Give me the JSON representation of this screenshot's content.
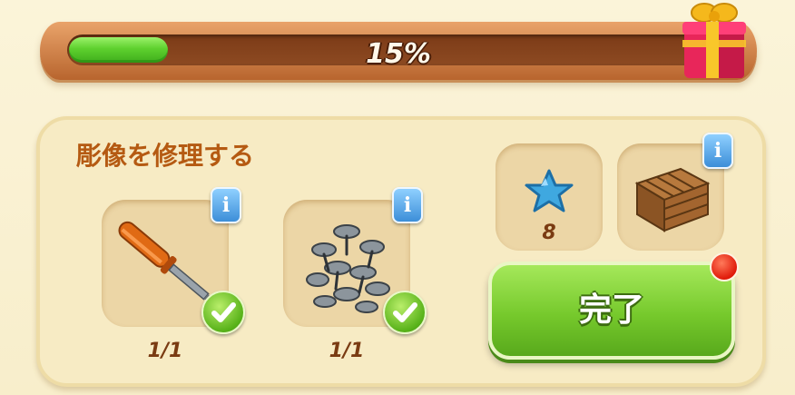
{
  "progress": {
    "percent_label": "15%",
    "value": 0.15
  },
  "panel": {
    "title": "彫像を修理する",
    "requirements": [
      {
        "name": "screwdriver",
        "count": "1/1",
        "complete": true
      },
      {
        "name": "screws",
        "count": "1/1",
        "complete": true
      }
    ],
    "rewards": [
      {
        "name": "blue-star",
        "amount": "8"
      },
      {
        "name": "wooden-crate"
      }
    ],
    "done_button": "完了"
  },
  "colors": {
    "progress_fill": "#5ed02e",
    "button_green": "#76c92c",
    "title_brown": "#b55a12",
    "info_blue": "#3c8ed8",
    "alert_red": "#e01a0a"
  }
}
